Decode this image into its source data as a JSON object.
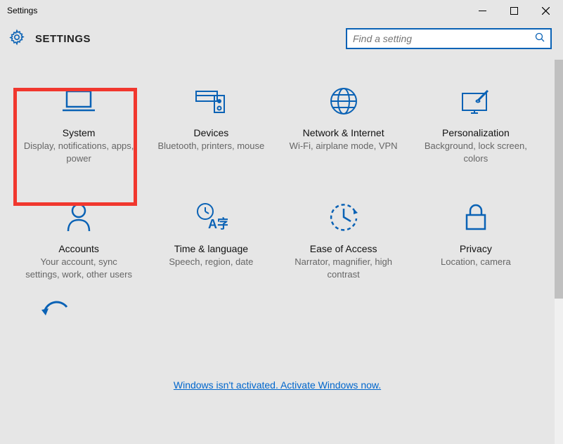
{
  "window": {
    "title": "Settings"
  },
  "header": {
    "title": "SETTINGS"
  },
  "search": {
    "placeholder": "Find a setting"
  },
  "tiles": [
    {
      "title": "System",
      "sub": "Display, notifications, apps, power"
    },
    {
      "title": "Devices",
      "sub": "Bluetooth, printers, mouse"
    },
    {
      "title": "Network & Internet",
      "sub": "Wi-Fi, airplane mode, VPN"
    },
    {
      "title": "Personalization",
      "sub": "Background, lock screen, colors"
    },
    {
      "title": "Accounts",
      "sub": "Your account, sync settings, work, other users"
    },
    {
      "title": "Time & language",
      "sub": "Speech, region, date"
    },
    {
      "title": "Ease of Access",
      "sub": "Narrator, magnifier, high contrast"
    },
    {
      "title": "Privacy",
      "sub": "Location, camera"
    }
  ],
  "activation": {
    "text": "Windows isn't activated. Activate Windows now."
  }
}
